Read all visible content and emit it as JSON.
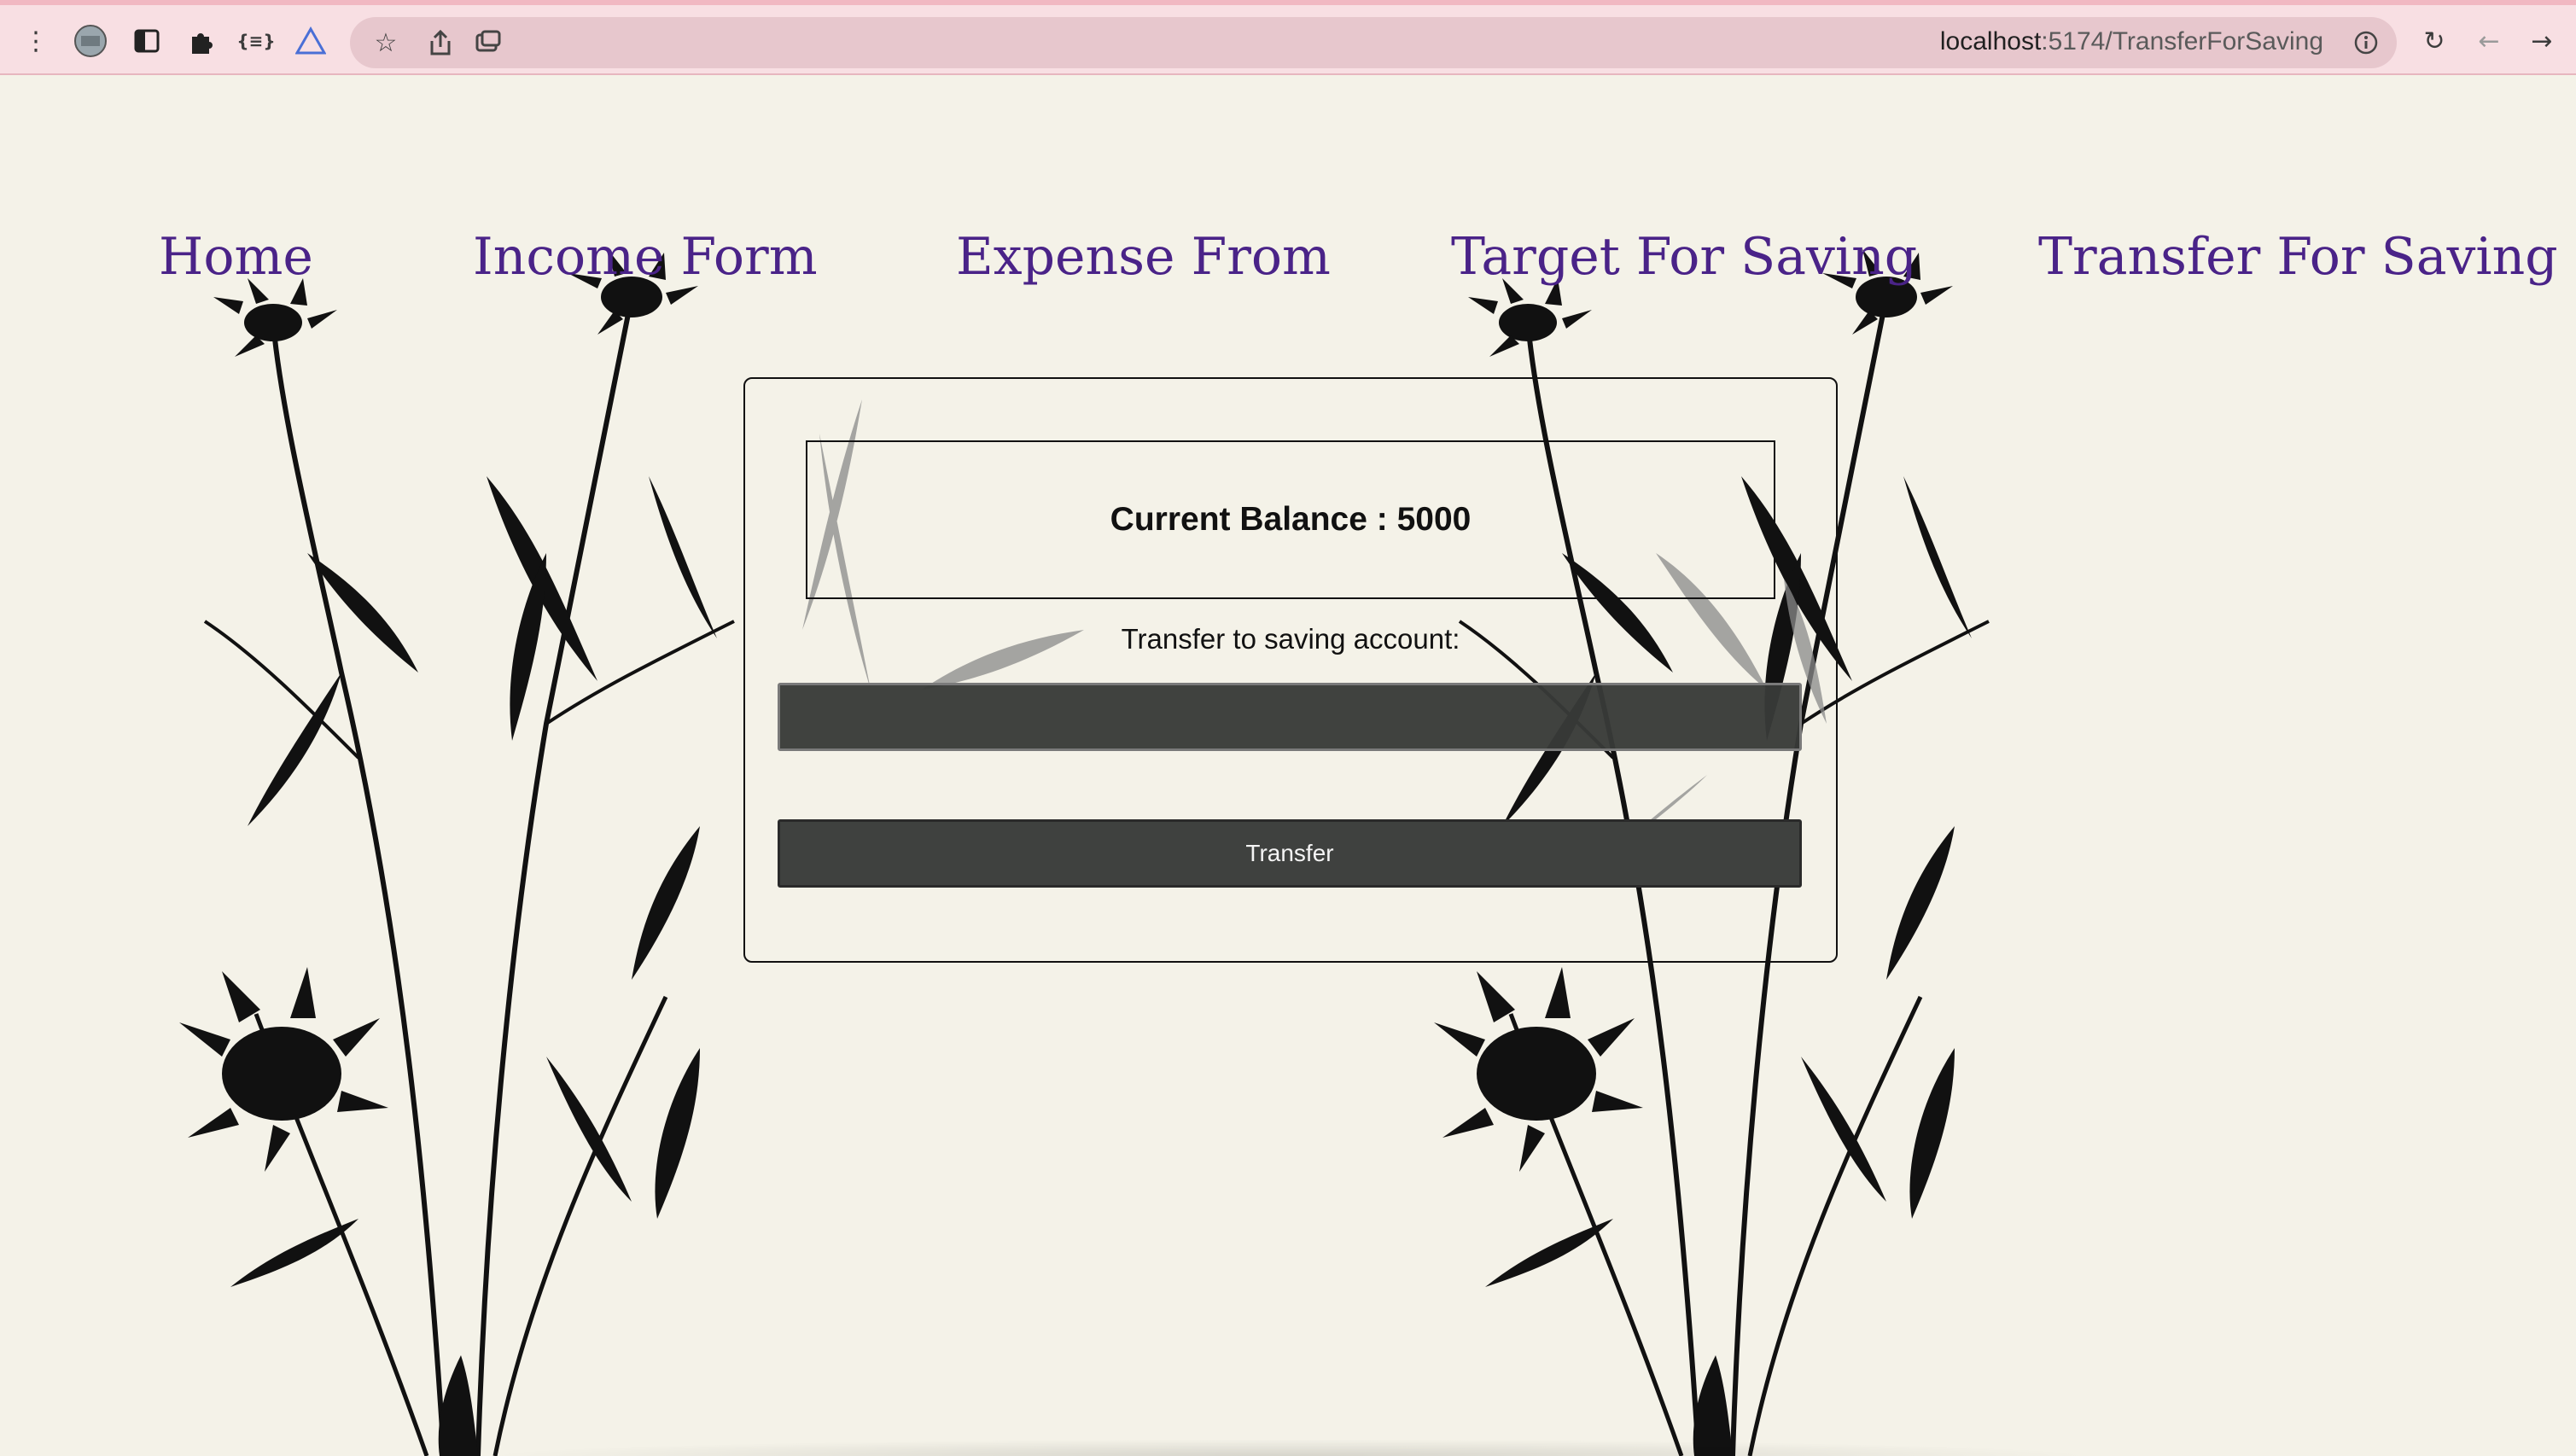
{
  "browser": {
    "url_host": "localhost",
    "url_path": ":5174/TransferForSaving",
    "icons": [
      "more-vert-icon",
      "profile-icon",
      "sidebar-icon",
      "extensions-icon",
      "json-icon",
      "vue-devtools-icon",
      "bookmark-star-icon",
      "share-icon",
      "tab-search-icon",
      "site-info-icon",
      "reload-icon",
      "back-icon",
      "forward-icon"
    ]
  },
  "nav": {
    "home": "Home",
    "income": "Income Form",
    "expense": "Expense From",
    "target": "Target For Saving",
    "transfer": "Transfer For Saving",
    "color": "#4a2388"
  },
  "main": {
    "balance_text": "Current Balance : 5000",
    "transfer_label": "Transfer to saving account:",
    "amount_value": "",
    "transfer_button": "Transfer"
  },
  "colors": {
    "background": "#f4f2e8",
    "browser_bar": "#f8dfe3",
    "input_bg": "#383a38"
  }
}
